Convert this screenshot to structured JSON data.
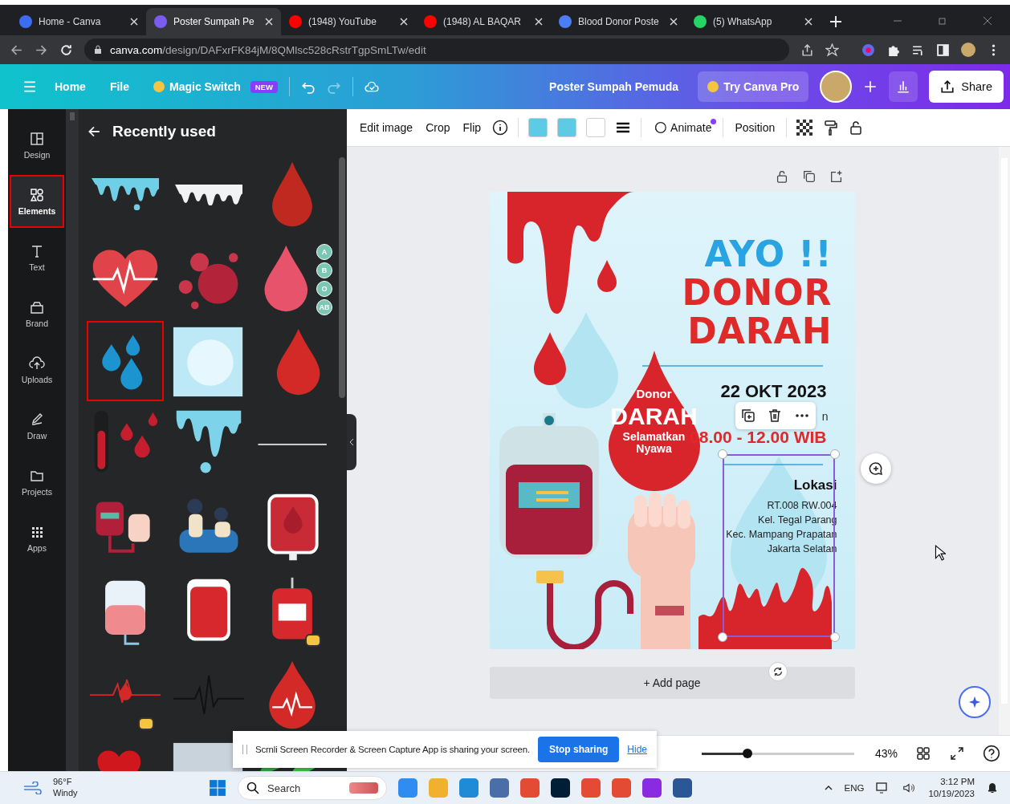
{
  "browser": {
    "tabs": [
      {
        "title": "Home - Canva",
        "selected": false
      },
      {
        "title": "Poster Sumpah Pe",
        "selected": true
      },
      {
        "title": "(1948) YouTube",
        "selected": false
      },
      {
        "title": "(1948) AL BAQAR",
        "selected": false
      },
      {
        "title": "Blood Donor Poste",
        "selected": false
      },
      {
        "title": "(5) WhatsApp",
        "selected": false
      }
    ],
    "url_host": "canva.com",
    "url_path": "/design/DAFxrFK84jM/8QMlsc528cRstrTgpSmLTw/edit"
  },
  "header": {
    "menu": [
      "Home",
      "File"
    ],
    "magic_switch": "Magic Switch",
    "badge": "NEW",
    "title": "Poster Sumpah Pemuda",
    "pro": "Try Canva Pro",
    "share": "Share"
  },
  "rail": [
    {
      "label": "Design",
      "selected": false
    },
    {
      "label": "Elements",
      "selected": true
    },
    {
      "label": "Text",
      "selected": false
    },
    {
      "label": "Brand",
      "selected": false
    },
    {
      "label": "Uploads",
      "selected": false
    },
    {
      "label": "Draw",
      "selected": false
    },
    {
      "label": "Projects",
      "selected": false
    },
    {
      "label": "Apps",
      "selected": false
    }
  ],
  "panel": {
    "title": "Recently used",
    "items": [
      {
        "kind": "drip-blue",
        "selected": false,
        "premium": false
      },
      {
        "kind": "drip-white",
        "selected": false,
        "premium": false
      },
      {
        "kind": "drop-dark",
        "selected": false,
        "premium": false
      },
      {
        "kind": "heart-pulse",
        "selected": false,
        "premium": false
      },
      {
        "kind": "cells",
        "selected": false,
        "premium": false
      },
      {
        "kind": "drop-types",
        "selected": false,
        "premium": false,
        "labels": [
          "A",
          "B",
          "O",
          "AB"
        ]
      },
      {
        "kind": "droplets",
        "selected": true,
        "premium": false
      },
      {
        "kind": "sky",
        "selected": false,
        "premium": false
      },
      {
        "kind": "drop-red",
        "selected": false,
        "premium": false
      },
      {
        "kind": "tube",
        "selected": false,
        "premium": false
      },
      {
        "kind": "drip-blue-single",
        "selected": false,
        "premium": false
      },
      {
        "kind": "line",
        "selected": false,
        "premium": false
      },
      {
        "kind": "iv-hand",
        "selected": false,
        "premium": false
      },
      {
        "kind": "donors",
        "selected": false,
        "premium": false
      },
      {
        "kind": "bag-label",
        "selected": false,
        "premium": false
      },
      {
        "kind": "bag-pink",
        "selected": false,
        "premium": false
      },
      {
        "kind": "bag-red",
        "selected": false,
        "premium": false
      },
      {
        "kind": "blood-bag",
        "selected": false,
        "premium": true
      },
      {
        "kind": "pulse-red",
        "selected": false,
        "premium": true
      },
      {
        "kind": "pulse-black",
        "selected": false,
        "premium": false
      },
      {
        "kind": "drop-pulse",
        "selected": false,
        "premium": false
      },
      {
        "kind": "heart",
        "selected": false
      },
      {
        "kind": "grey",
        "selected": false
      },
      {
        "kind": "leaf",
        "selected": false
      }
    ]
  },
  "toolbar": {
    "actions": [
      "Edit image",
      "Crop",
      "Flip"
    ],
    "swatches": [
      {
        "color": "#5ccbe3"
      },
      {
        "color": "#5ccbe3"
      },
      {
        "color": "#ffffff"
      }
    ],
    "animate": "Animate",
    "position": "Position"
  },
  "poster": {
    "headline": [
      "AYO !!",
      "DONOR",
      "DARAH"
    ],
    "drop_text": [
      "Donor",
      "DARAH",
      "Selamatkan",
      "Nyawa"
    ],
    "date": "22 OKT 2023",
    "covered_line": "n",
    "time": "08.00 - 12.00 WIB",
    "location_title": "Lokasi",
    "address": [
      "RT.008 RW.004",
      "Kel. Tegal Parang",
      "Kec. Mampang Prapatan",
      "Jakarta Selatan"
    ]
  },
  "add_page": "+ Add page",
  "share_bar": {
    "message": "Scrnli Screen Recorder & Screen Capture App is sharing your screen.",
    "stop": "Stop sharing",
    "hide": "Hide"
  },
  "zoom": {
    "level": 0.3,
    "reading": "43%"
  },
  "taskbar": {
    "temp": "96°F",
    "weather": "Windy",
    "search": "Search",
    "lang": "ENG",
    "time": "3:12 PM",
    "date": "10/19/2023"
  }
}
